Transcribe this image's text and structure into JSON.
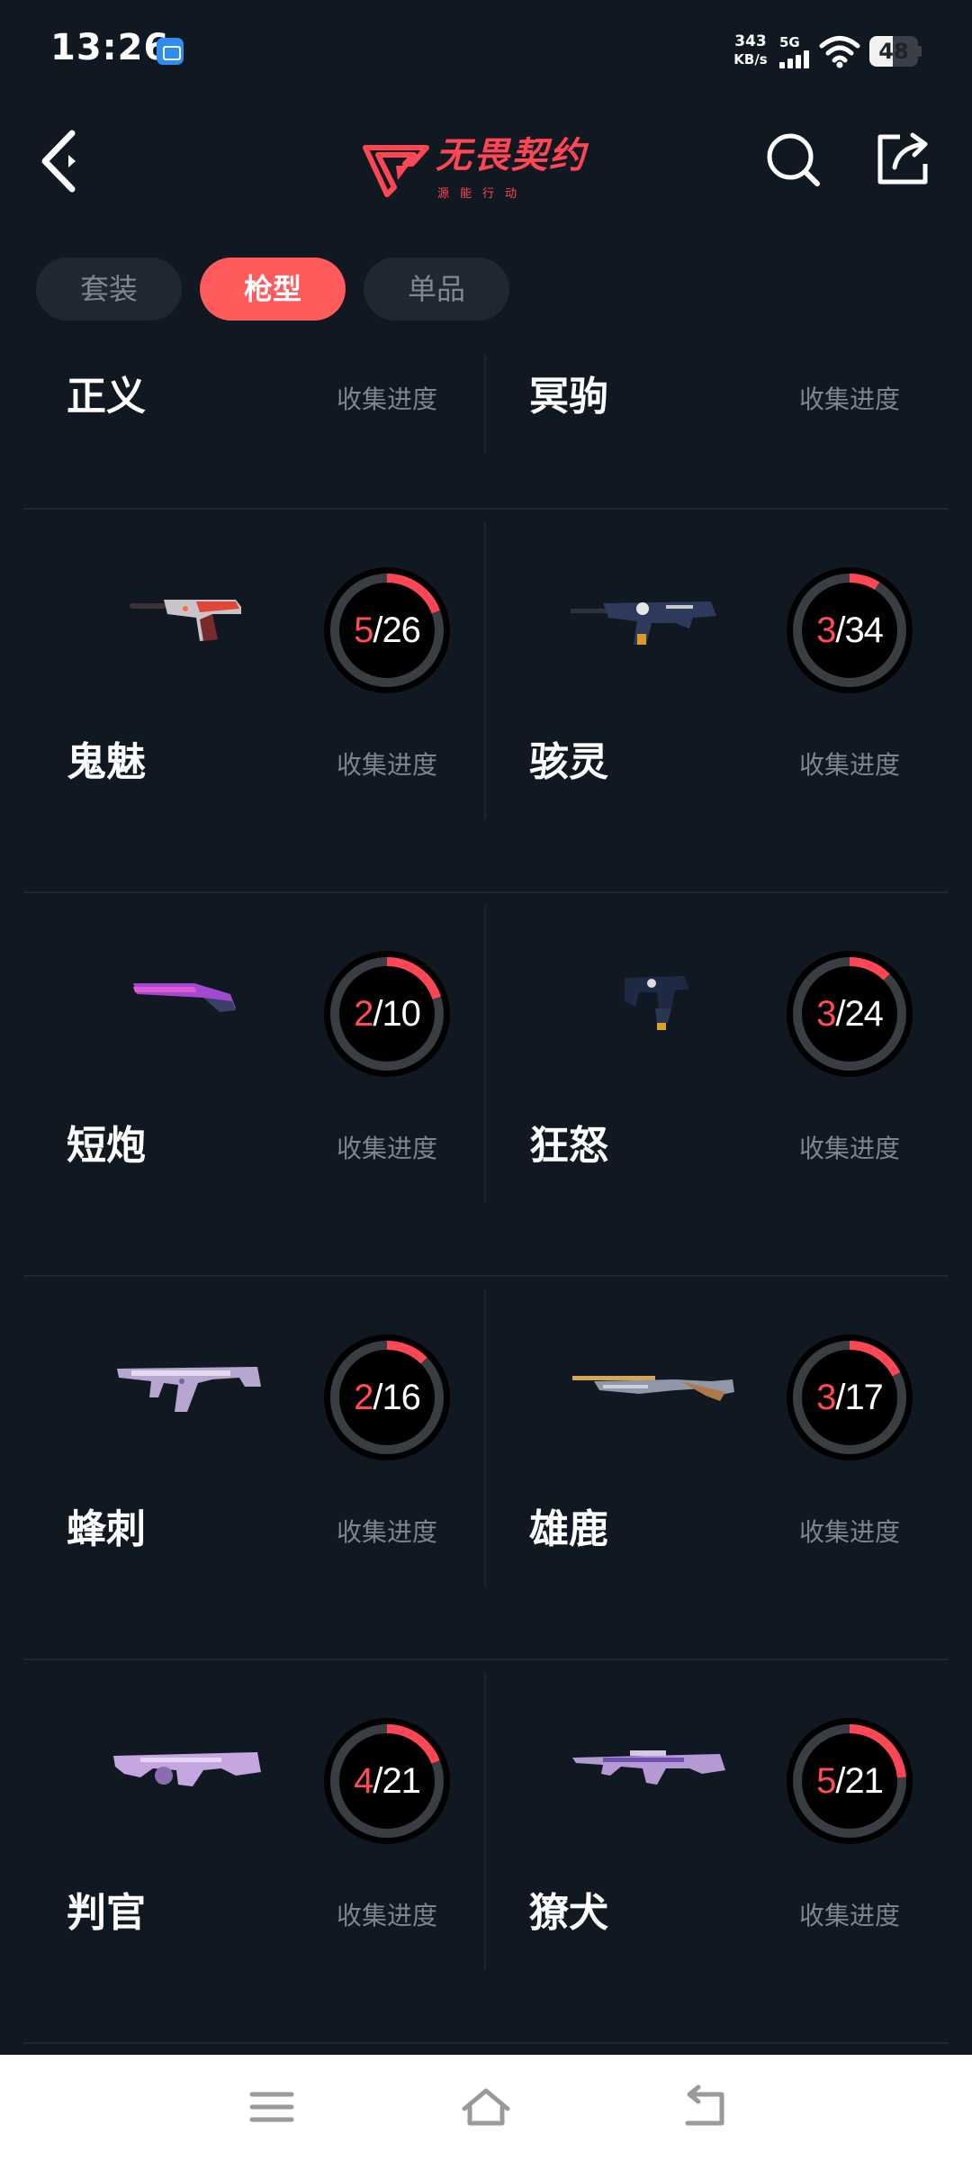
{
  "status_bar": {
    "time": "13:26",
    "net_speed": "343",
    "net_unit": "KB/s",
    "network": "5G",
    "battery": "48",
    "battery_level": 0.48,
    "app_icon": "du-icon"
  },
  "header": {
    "logo_title": "无畏契约",
    "logo_subtitle": "源能行动",
    "back_icon": "back-chevron-icon",
    "search_icon": "search-icon",
    "share_icon": "share-icon"
  },
  "tabs": [
    {
      "label": "套装",
      "active": false
    },
    {
      "label": "枪型",
      "active": true
    },
    {
      "label": "单品",
      "active": false
    }
  ],
  "colors": {
    "accent": "#ff4655",
    "ring_track": "#3a3d42",
    "background": "#101821"
  },
  "progress_label": "收集进度",
  "top_row": [
    {
      "name": "正义",
      "progress_label": "收集进度"
    },
    {
      "name": "冥驹",
      "progress_label": "收集进度"
    }
  ],
  "items": [
    {
      "name": "鬼魅",
      "collected": "5",
      "total": "26",
      "progress_label": "收集进度",
      "icon": "pistol-icon"
    },
    {
      "name": "骇灵",
      "collected": "3",
      "total": "34",
      "progress_label": "收集进度",
      "icon": "smg-icon"
    },
    {
      "name": "短炮",
      "collected": "2",
      "total": "10",
      "progress_label": "收集进度",
      "icon": "shotgun-icon"
    },
    {
      "name": "狂怒",
      "collected": "3",
      "total": "24",
      "progress_label": "收集进度",
      "icon": "machine-pistol-icon"
    },
    {
      "name": "蜂刺",
      "collected": "2",
      "total": "16",
      "progress_label": "收集进度",
      "icon": "submachine-gun-icon"
    },
    {
      "name": "雄鹿",
      "collected": "3",
      "total": "17",
      "progress_label": "收集进度",
      "icon": "pump-shotgun-icon"
    },
    {
      "name": "判官",
      "collected": "4",
      "total": "21",
      "progress_label": "收集进度",
      "icon": "auto-shotgun-icon"
    },
    {
      "name": "獠犬",
      "collected": "5",
      "total": "21",
      "progress_label": "收集进度",
      "icon": "rifle-icon"
    }
  ],
  "nav": {
    "menu_icon": "menu-icon",
    "home_icon": "home-icon",
    "back_icon": "nav-back-icon"
  }
}
